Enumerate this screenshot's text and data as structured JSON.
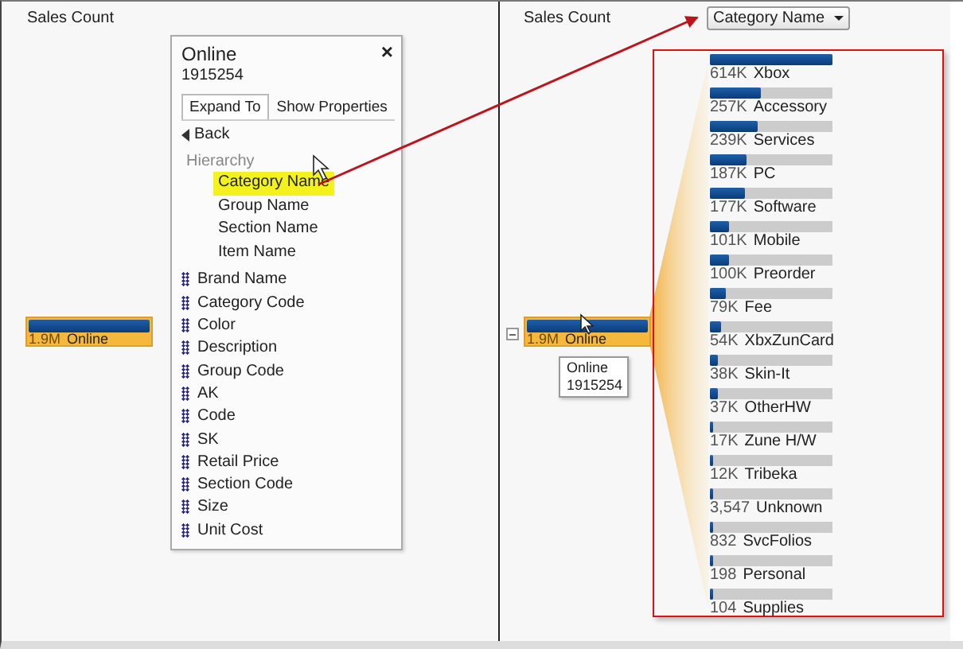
{
  "left_panel": {
    "header": "Sales Count",
    "node": {
      "value": "1.9M",
      "label": "Online",
      "level": 1
    }
  },
  "popup": {
    "title": "Online",
    "value": "1915254",
    "close": "×",
    "tabs": [
      {
        "label": "Expand To",
        "selected": true
      },
      {
        "label": "Show Properties",
        "selected": false
      }
    ],
    "back": "Back",
    "hierarchy": {
      "label": "Hierarchy",
      "items": [
        {
          "label": "Category Name",
          "selected": true
        },
        {
          "label": "Group Name",
          "selected": false
        },
        {
          "label": "Section Name",
          "selected": false
        },
        {
          "label": "Item Name",
          "selected": false
        }
      ]
    },
    "attributes": [
      "Brand Name",
      "Category Code",
      "Color",
      "Description",
      "Group Code",
      "AK",
      "Code",
      "SK",
      "Retail Price",
      "Section Code",
      "Size",
      "Unit Cost"
    ]
  },
  "right_panel": {
    "header": "Sales Count",
    "dropdown": "Category Name",
    "node": {
      "value": "1.9M",
      "label": "Online",
      "level": 1
    },
    "tooltip": {
      "title": "Online",
      "value": "1915254"
    },
    "items": [
      {
        "value": "614K",
        "label": "Xbox",
        "level": 1
      },
      {
        "value": "257K",
        "label": "Accessory",
        "level": 0.42
      },
      {
        "value": "239K",
        "label": "Services",
        "level": 0.39
      },
      {
        "value": "187K",
        "label": "PC",
        "level": 0.3
      },
      {
        "value": "177K",
        "label": "Software",
        "level": 0.29
      },
      {
        "value": "101K",
        "label": "Mobile",
        "level": 0.16
      },
      {
        "value": "100K",
        "label": "Preorder",
        "level": 0.16
      },
      {
        "value": "79K",
        "label": "Fee",
        "level": 0.13
      },
      {
        "value": "54K",
        "label": "XbxZunCard",
        "level": 0.09
      },
      {
        "value": "38K",
        "label": "Skin-It",
        "level": 0.06
      },
      {
        "value": "37K",
        "label": "OtherHW",
        "level": 0.06
      },
      {
        "value": "17K",
        "label": "Zune H/W",
        "level": 0.03
      },
      {
        "value": "12K",
        "label": "Tribeka",
        "level": 0.02
      },
      {
        "value": "3,547",
        "label": "Unknown",
        "level": 0.01
      },
      {
        "value": "832",
        "label": "SvcFolios",
        "level": 0.01
      },
      {
        "value": "198",
        "label": "Personal",
        "level": 0.01
      },
      {
        "value": "104",
        "label": "Supplies",
        "level": 0.01
      }
    ]
  }
}
